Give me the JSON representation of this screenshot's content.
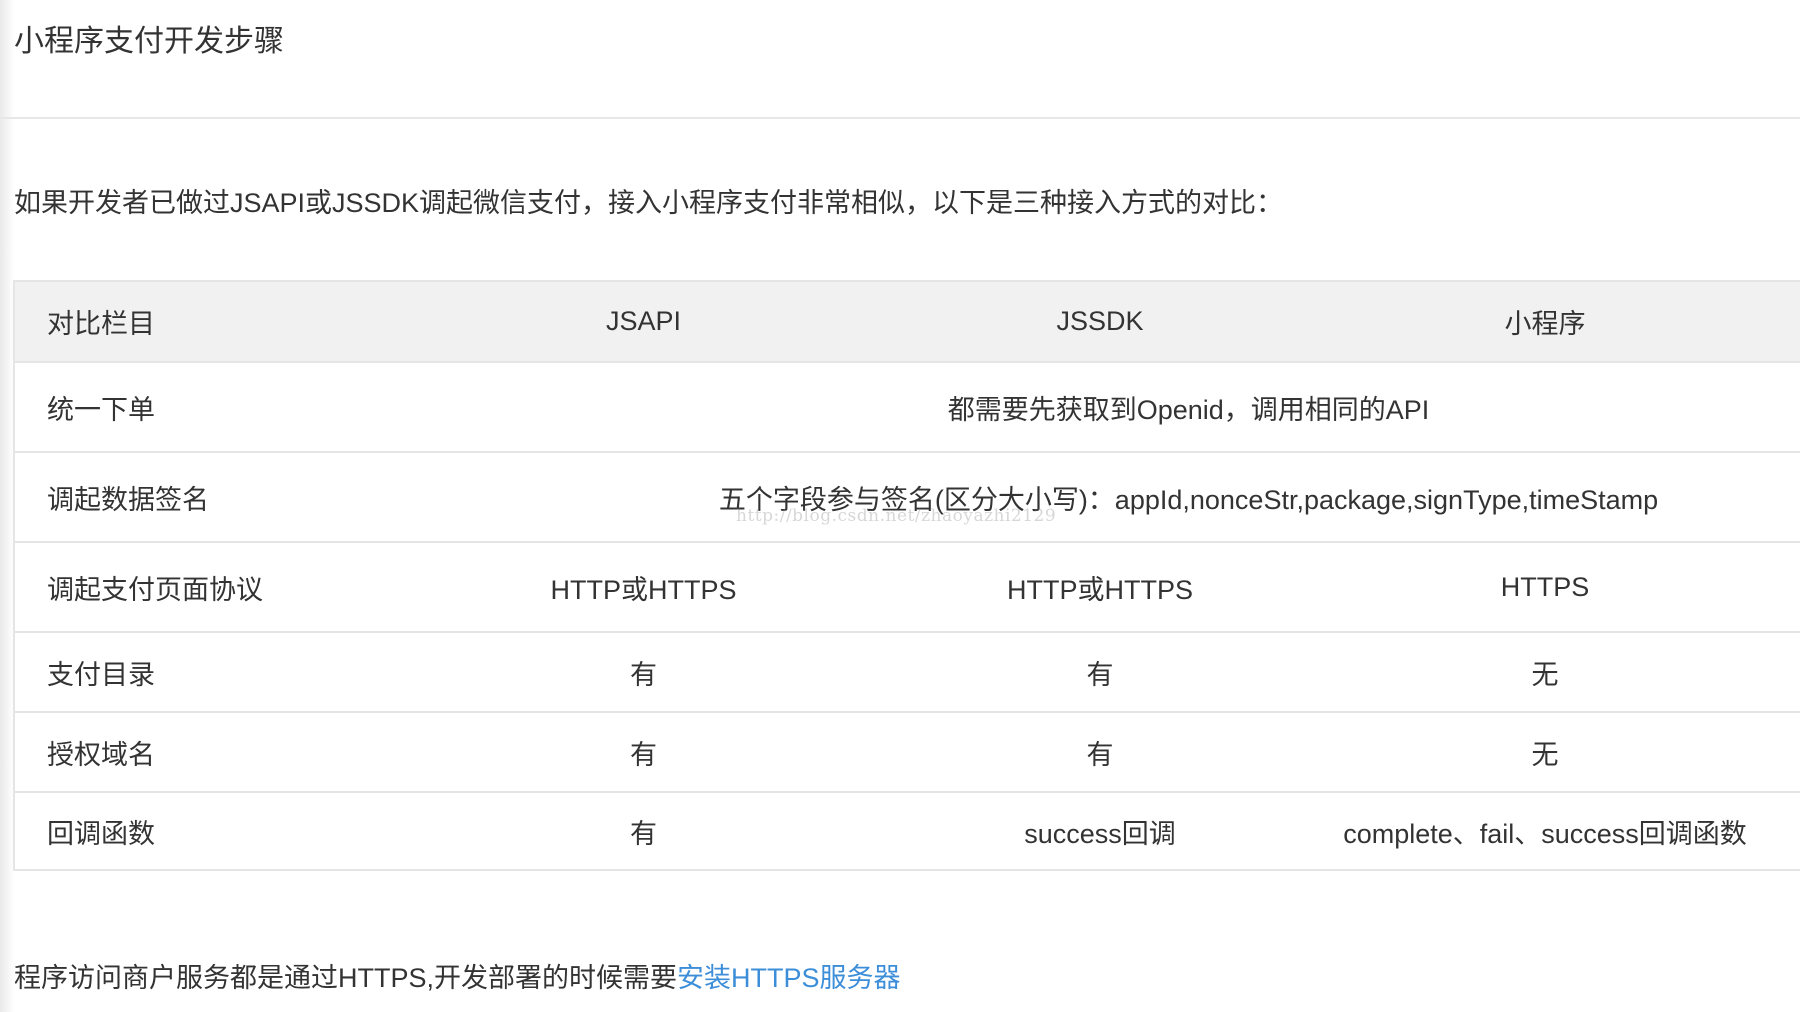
{
  "page": {
    "title": "小程序支付开发步骤",
    "intro": "如果开发者已做过JSAPI或JSSDK调起微信支付，接入小程序支付非常相似，以下是三种接入方式的对比："
  },
  "table": {
    "headers": [
      "对比栏目",
      "JSAPI",
      "JSSDK",
      "小程序"
    ],
    "rows": [
      {
        "label": "统一下单",
        "merged": "都需要先获取到Openid，调用相同的API"
      },
      {
        "label": "调起数据签名",
        "merged": "五个字段参与签名(区分大小写)：appId,nonceStr,package,signType,timeStamp"
      },
      {
        "label": "调起支付页面协议",
        "cells": [
          "HTTP或HTTPS",
          "HTTP或HTTPS",
          "HTTPS"
        ]
      },
      {
        "label": "支付目录",
        "cells": [
          "有",
          "有",
          "无"
        ]
      },
      {
        "label": "授权域名",
        "cells": [
          "有",
          "有",
          "无"
        ]
      },
      {
        "label": "回调函数",
        "cells": [
          "有",
          "success回调",
          "complete、fail、success回调函数"
        ]
      }
    ]
  },
  "footer": {
    "text": "程序访问商户服务都是通过HTTPS,开发部署的时候需要",
    "link_label": "安装HTTPS服务器"
  },
  "watermark": "http://blog.csdn.net/zhaoyazhi2129",
  "colors": {
    "link": "#3d8ed9",
    "header_bg": "#f1f1f1",
    "border": "#e5e5e5",
    "text": "#333333"
  }
}
